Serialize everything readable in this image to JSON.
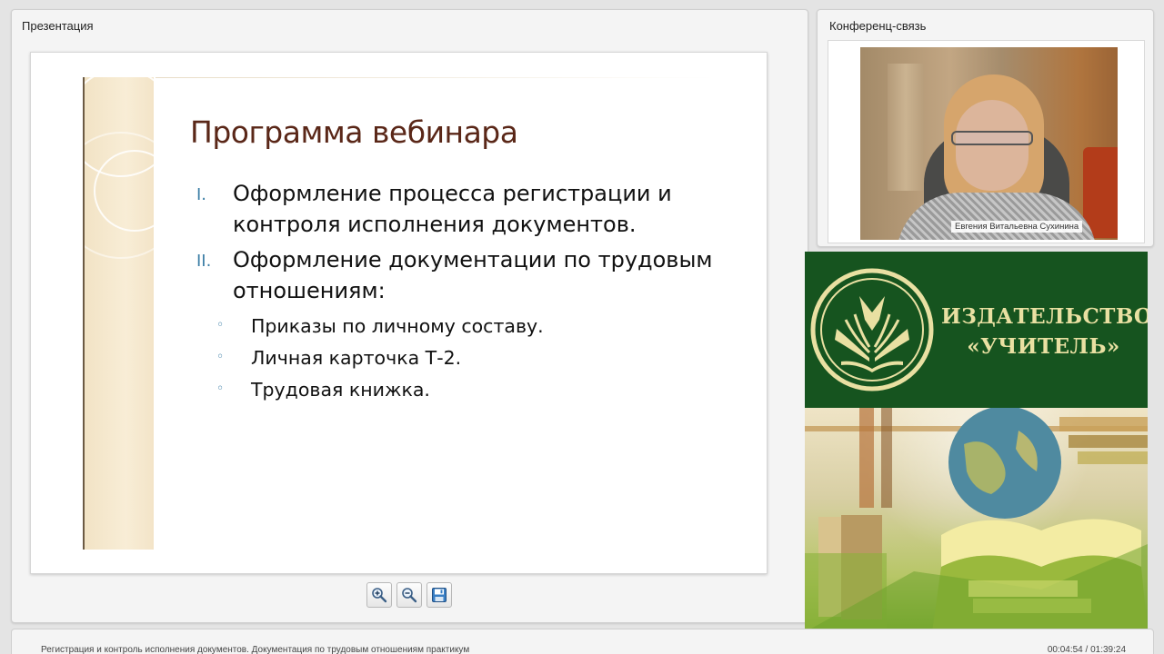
{
  "presentation": {
    "panel_title": "Презентация",
    "slide": {
      "title": "Программа вебинара",
      "items": [
        {
          "num": "I.",
          "text": "Оформление процесса регистрации и контроля исполнения документов."
        },
        {
          "num": "II.",
          "text": "Оформление документации по трудовым отношениям:"
        }
      ],
      "subitems": [
        {
          "bullet": "◦",
          "text": "Приказы по личному составу."
        },
        {
          "bullet": "◦",
          "text": "Личная карточка Т-2."
        },
        {
          "bullet": "◦",
          "text": "Трудовая книжка."
        }
      ]
    },
    "toolbar": {
      "zoom_in_icon": "zoom-in-icon",
      "zoom_out_icon": "zoom-out-icon",
      "save_icon": "save-icon"
    }
  },
  "conference": {
    "panel_title": "Конференц-связь",
    "participant_name": "Евгения Витальевна Сухинина"
  },
  "banner": {
    "line1": "ИЗДАТЕЛЬСТВО",
    "line2": "«УЧИТЕЛЬ»",
    "colors": {
      "background": "#16541f",
      "text": "#e9e0a2"
    }
  },
  "footer": {
    "title": "Регистрация и контроль исполнения документов. Документация по трудовым отношениям практикум",
    "time": "00:04:54 / 01:39:24"
  }
}
